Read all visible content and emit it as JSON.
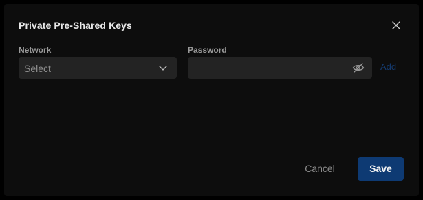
{
  "dialog": {
    "title": "Private Pre-Shared Keys",
    "close_icon": "close-icon"
  },
  "form": {
    "network": {
      "label": "Network",
      "selected": "Select",
      "icon": "chevron-down-icon"
    },
    "password": {
      "label": "Password",
      "value": "",
      "visibility_icon": "eye-off-icon"
    },
    "add_label": "Add"
  },
  "footer": {
    "cancel_label": "Cancel",
    "save_label": "Save"
  },
  "colors": {
    "background": "#0d0d0d",
    "input_bg": "#232323",
    "primary_button": "#0e3a73",
    "add_link": "#143a6e"
  }
}
